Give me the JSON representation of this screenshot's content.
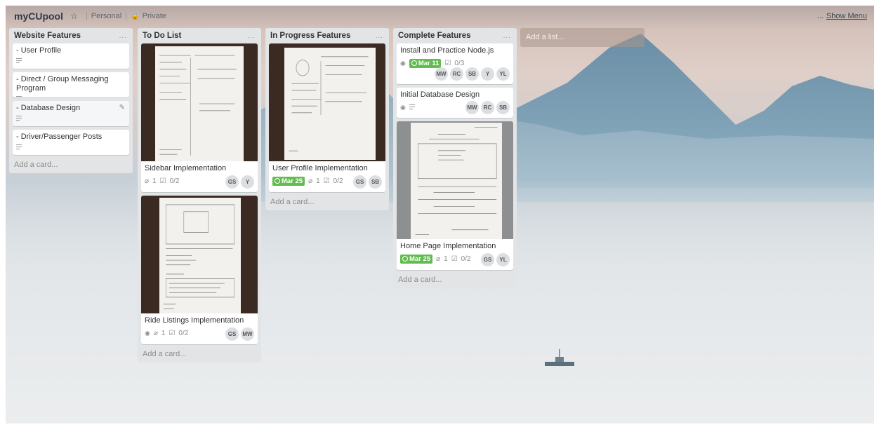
{
  "board": {
    "title": "myCUpool",
    "star_icon": "star-icon",
    "team": "Personal",
    "visibility": "Private",
    "show_menu": "Show Menu",
    "more_icon": "..."
  },
  "lists": [
    {
      "title": "Website Features",
      "menu": "...",
      "add_card": "Add a card...",
      "cards": [
        {
          "title": "- User Profile"
        },
        {
          "title": "- Direct / Group Messaging Program"
        },
        {
          "title": "- Database Design"
        },
        {
          "title": "- Driver/Passenger Posts"
        }
      ]
    },
    {
      "title": "To Do List",
      "menu": "...",
      "add_card": "Add a card...",
      "cards": [
        {
          "title": "Sidebar Implementation",
          "attachments": "1",
          "checklist": "0/2",
          "members": [
            "GS",
            "Y"
          ]
        },
        {
          "title": "Ride Listings Implementation",
          "attachments": "1",
          "checklist": "0/2",
          "members": [
            "GS",
            "MW"
          ]
        }
      ]
    },
    {
      "title": "In Progress Features",
      "menu": "...",
      "add_card": "Add a card...",
      "cards": [
        {
          "title": "User Profile Implementation",
          "due": "Mar 25",
          "attachments": "1",
          "checklist": "0/2",
          "members": [
            "GS",
            "SB"
          ]
        }
      ]
    },
    {
      "title": "Complete Features",
      "menu": "...",
      "add_card": "Add a card...",
      "cards": [
        {
          "title": "Install and Practice Node.js",
          "due": "Mar 11",
          "checklist": "0/3",
          "members": [
            "MW",
            "RC",
            "SB",
            "Y",
            "YL"
          ]
        },
        {
          "title": "Initial Database Design",
          "members": [
            "MW",
            "RC",
            "SB"
          ]
        },
        {
          "title": "Home Page Implementation",
          "due": "Mar 25",
          "attachments": "1",
          "checklist": "0/2",
          "members": [
            "GS",
            "YL"
          ]
        }
      ]
    }
  ],
  "add_list": "Add a list...",
  "colors": {
    "due_green": "#61bd4f",
    "list_bg": "#e2e4e6",
    "board_title": "#2e3a48"
  }
}
